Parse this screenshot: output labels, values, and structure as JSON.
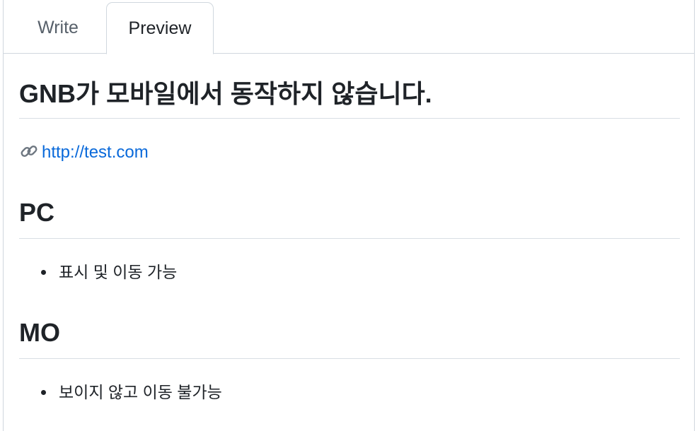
{
  "tabs": {
    "write_label": "Write",
    "preview_label": "Preview",
    "active": "Preview"
  },
  "preview": {
    "title": "GNB가 모바일에서 동작하지 않습니다.",
    "link": {
      "icon": "link-icon",
      "text": "http://test.com"
    },
    "sections": [
      {
        "heading": "PC",
        "items": [
          "표시 및 이동 가능"
        ]
      },
      {
        "heading": "MO",
        "items": [
          "보이지 않고 이동 불가능"
        ]
      }
    ]
  },
  "colors": {
    "link": "#0969da",
    "text": "#1f2328",
    "muted_tab": "#57606a",
    "border": "#d0d7de"
  }
}
